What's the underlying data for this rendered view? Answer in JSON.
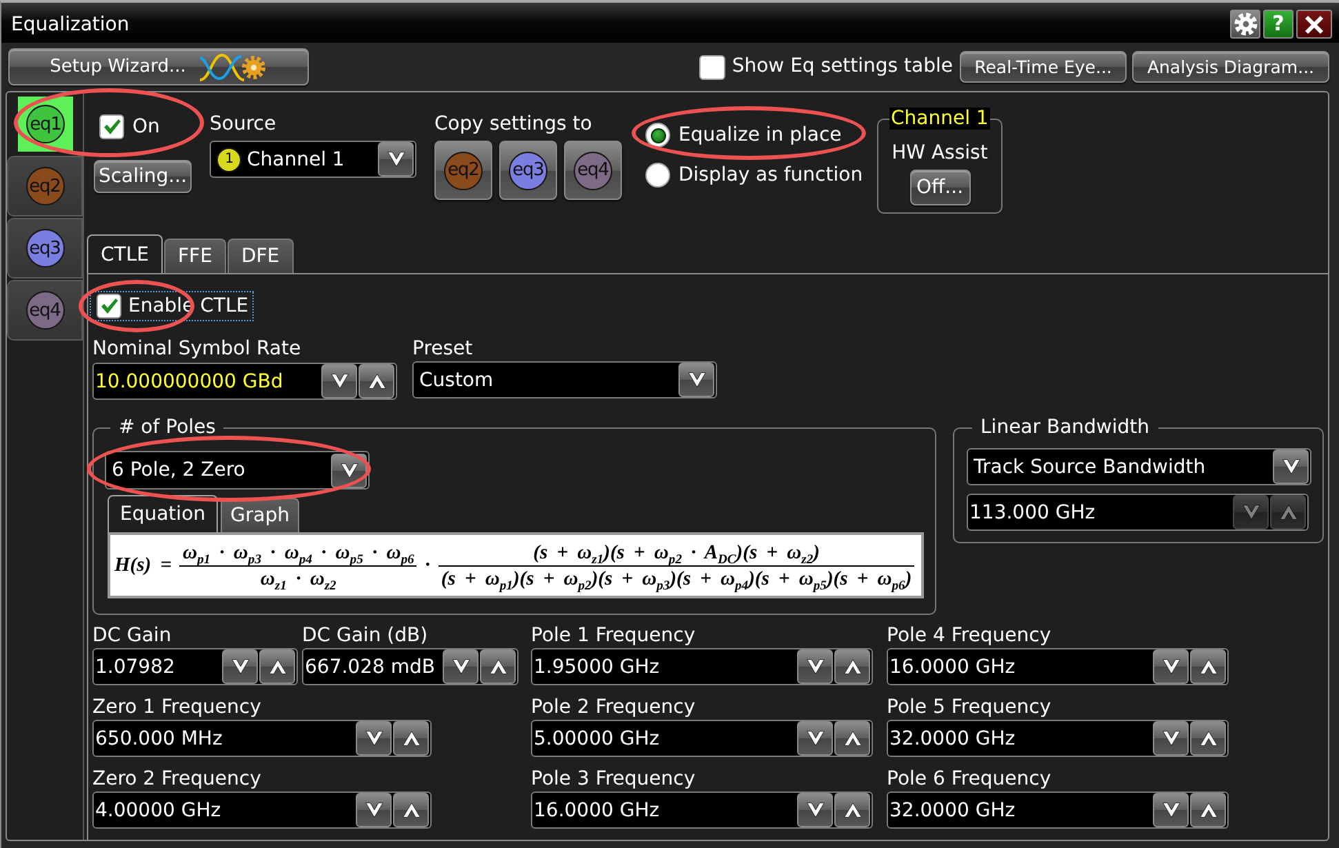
{
  "window": {
    "title": "Equalization",
    "help_label": "?"
  },
  "toolbar": {
    "setup_wizard": "Setup Wizard...",
    "show_table": {
      "label": "Show Eq settings table",
      "checked": false
    },
    "buttons": [
      "Real-Time Eye...",
      "Analysis Diagram..."
    ]
  },
  "equalizers": [
    {
      "label": "eq1",
      "color": "#3fc43f",
      "selected": true
    },
    {
      "label": "eq2",
      "color": "#8a4a1c",
      "selected": false
    },
    {
      "label": "eq3",
      "color": "#7a7ee0",
      "selected": false
    },
    {
      "label": "eq4",
      "color": "#7c6a86",
      "selected": false
    }
  ],
  "on": {
    "label": "On",
    "checked": true,
    "highlighted": true
  },
  "scaling_button": "Scaling...",
  "source": {
    "label": "Source",
    "channel_badge": "1",
    "value": "Channel 1"
  },
  "copy_settings": {
    "label": "Copy settings to",
    "targets": [
      {
        "label": "eq2",
        "color": "#8a4a1c"
      },
      {
        "label": "eq3",
        "color": "#7a7ee0"
      },
      {
        "label": "eq4",
        "color": "#7c6a86"
      }
    ]
  },
  "output_mode": [
    {
      "label": "Equalize in place",
      "selected": true,
      "highlighted": true
    },
    {
      "label": "Display as function",
      "selected": false,
      "highlighted": false
    }
  ],
  "hw_assist": {
    "channel": "Channel 1",
    "label": "HW Assist",
    "button": "Off..."
  },
  "tabs": [
    {
      "label": "CTLE",
      "selected": true
    },
    {
      "label": "FFE",
      "selected": false
    },
    {
      "label": "DFE",
      "selected": false
    }
  ],
  "ctle": {
    "enable": {
      "label": "Enable CTLE",
      "checked": true,
      "highlighted": true
    },
    "symbol_rate": {
      "label": "Nominal Symbol Rate",
      "value": "10.000000000 GBd"
    },
    "preset": {
      "label": "Preset",
      "value": "Custom"
    },
    "poles": {
      "label": "# of Poles",
      "value": "6 Pole, 2 Zero",
      "highlighted": true,
      "view_tabs": [
        {
          "label": "Equation",
          "selected": true
        },
        {
          "label": "Graph",
          "selected": false
        }
      ],
      "equation": {
        "lhs": "H(s) =",
        "gain": {
          "numerator": "ω$_{p1}$ · ω$_{p3}$ · ω$_{p4}$ · ω$_{p5}$ · ω$_{p6}$",
          "denominator": "ω$_{z1}$ · ω$_{z2}$"
        },
        "operator": "·",
        "response": {
          "numerator": "(s + ω$_{z1}$)(s + ω$_{p2}$ · A$_{DC}$)(s + ω$_{z2}$)",
          "denominator": "(s + ω$_{p1}$)(s + ω$_{p2}$)(s + ω$_{p3}$)(s + ω$_{p4}$)(s + ω$_{p5}$)(s + ω$_{p6}$)"
        }
      }
    },
    "linear_bandwidth": {
      "label": "Linear Bandwidth",
      "mode": "Track Source Bandwidth",
      "value": "113.000 GHz",
      "spin_disabled": true
    },
    "gain_fields": [
      {
        "label": "DC Gain",
        "value": "1.07982"
      },
      {
        "label": "DC Gain (dB)",
        "value": "667.028 mdB"
      }
    ],
    "zero_fields": [
      {
        "label": "Zero 1 Frequency",
        "value": "650.000 MHz"
      },
      {
        "label": "Zero 2 Frequency",
        "value": "4.00000 GHz"
      }
    ],
    "pole_fields": [
      {
        "label": "Pole 1 Frequency",
        "value": "1.95000 GHz"
      },
      {
        "label": "Pole 2 Frequency",
        "value": "5.00000 GHz"
      },
      {
        "label": "Pole 3 Frequency",
        "value": "16.0000 GHz"
      },
      {
        "label": "Pole 4 Frequency",
        "value": "16.0000 GHz"
      },
      {
        "label": "Pole 5 Frequency",
        "value": "32.0000 GHz"
      },
      {
        "label": "Pole 6 Frequency",
        "value": "32.0000 GHz"
      }
    ]
  }
}
